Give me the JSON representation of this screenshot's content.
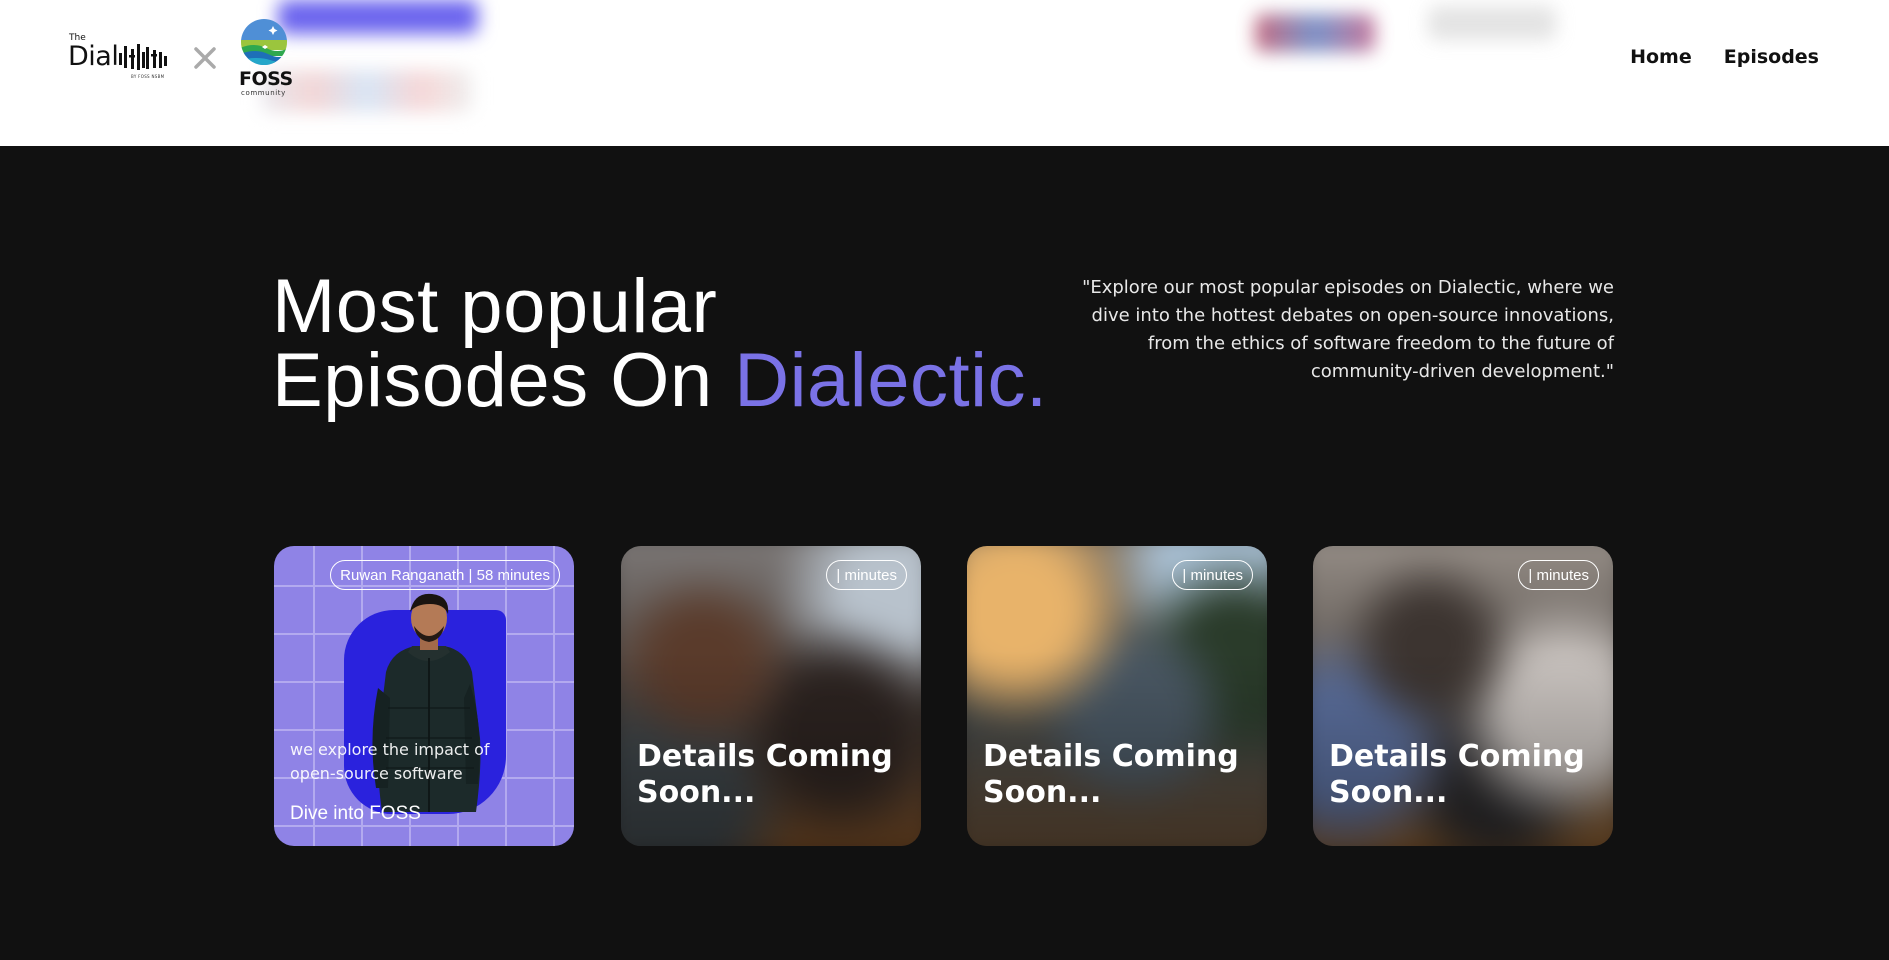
{
  "header": {
    "logo": {
      "the_text": "The",
      "word_text": "Dial",
      "by_text": "BY FOSS NSBM"
    },
    "partner_logo": {
      "name": "FOSS",
      "sub": "community"
    },
    "nav": {
      "home_label": "Home",
      "episodes_label": "Episodes"
    }
  },
  "hero": {
    "headline_line1": "Most popular",
    "headline_line2": "Episodes On ",
    "headline_accent": "Dialectic.",
    "quote": "\"Explore our most popular episodes on Dialectic, where we dive into the hottest debates on open-source innovations, from the ethics of software freedom to the future of community-driven development.\""
  },
  "cards": [
    {
      "badge": "Ruwan Ranganath | 58 minutes",
      "description": "we explore the impact of open-source software",
      "title": "Dive into FOSS"
    },
    {
      "badge": "| minutes",
      "title": "Details Coming Soon..."
    },
    {
      "badge": "| minutes",
      "title": "Details Coming Soon..."
    },
    {
      "badge": "| minutes",
      "title": "Details Coming Soon..."
    }
  ],
  "colors": {
    "accent": "#7a72e6",
    "page_bg": "#111111",
    "header_bg": "#ffffff",
    "card1_bg": "#8f83e6"
  }
}
